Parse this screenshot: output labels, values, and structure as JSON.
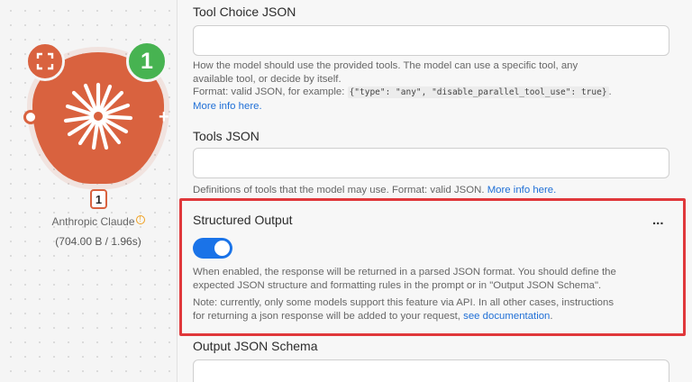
{
  "node": {
    "name": "Anthropic Claude",
    "operation_count": "1",
    "index_label": "1",
    "meta": "(704.00 B / 1.96s)",
    "color": "#d9623f",
    "badge_color": "#47b351"
  },
  "fields": {
    "tool_choice": {
      "label": "Tool Choice JSON",
      "value": "",
      "help_line1": "How the model should use the provided tools. The model can use a specific tool, any",
      "help_line2": "available tool, or decide by itself.",
      "help_format_prefix": "Format: valid JSON, for example:",
      "help_example": "{\"type\": \"any\", \"disable_parallel_tool_use\": true}",
      "help_format_suffix": ".",
      "more_info": "More info here."
    },
    "tools": {
      "label": "Tools JSON",
      "value": "",
      "help": "Definitions of tools that the model may use. Format: valid JSON.",
      "more_info": "More info here."
    },
    "structured_output": {
      "label": "Structured Output",
      "enabled": true,
      "more_label": "...",
      "desc_line1": "When enabled, the response will be returned in a parsed JSON format. You should define the",
      "desc_line2": "expected JSON structure and formatting rules in the prompt or in \"Output JSON Schema\".",
      "note_line1": "Note: currently, only some models support this feature via API. In all other cases, instructions",
      "note_line2": "for returning a json response will be added to your request,",
      "doc_link": "see documentation",
      "note_end": ".",
      "highlight_color": "#e0383b",
      "toggle_color": "#1a73e8"
    },
    "output_schema": {
      "label": "Output JSON Schema",
      "value": ""
    }
  }
}
